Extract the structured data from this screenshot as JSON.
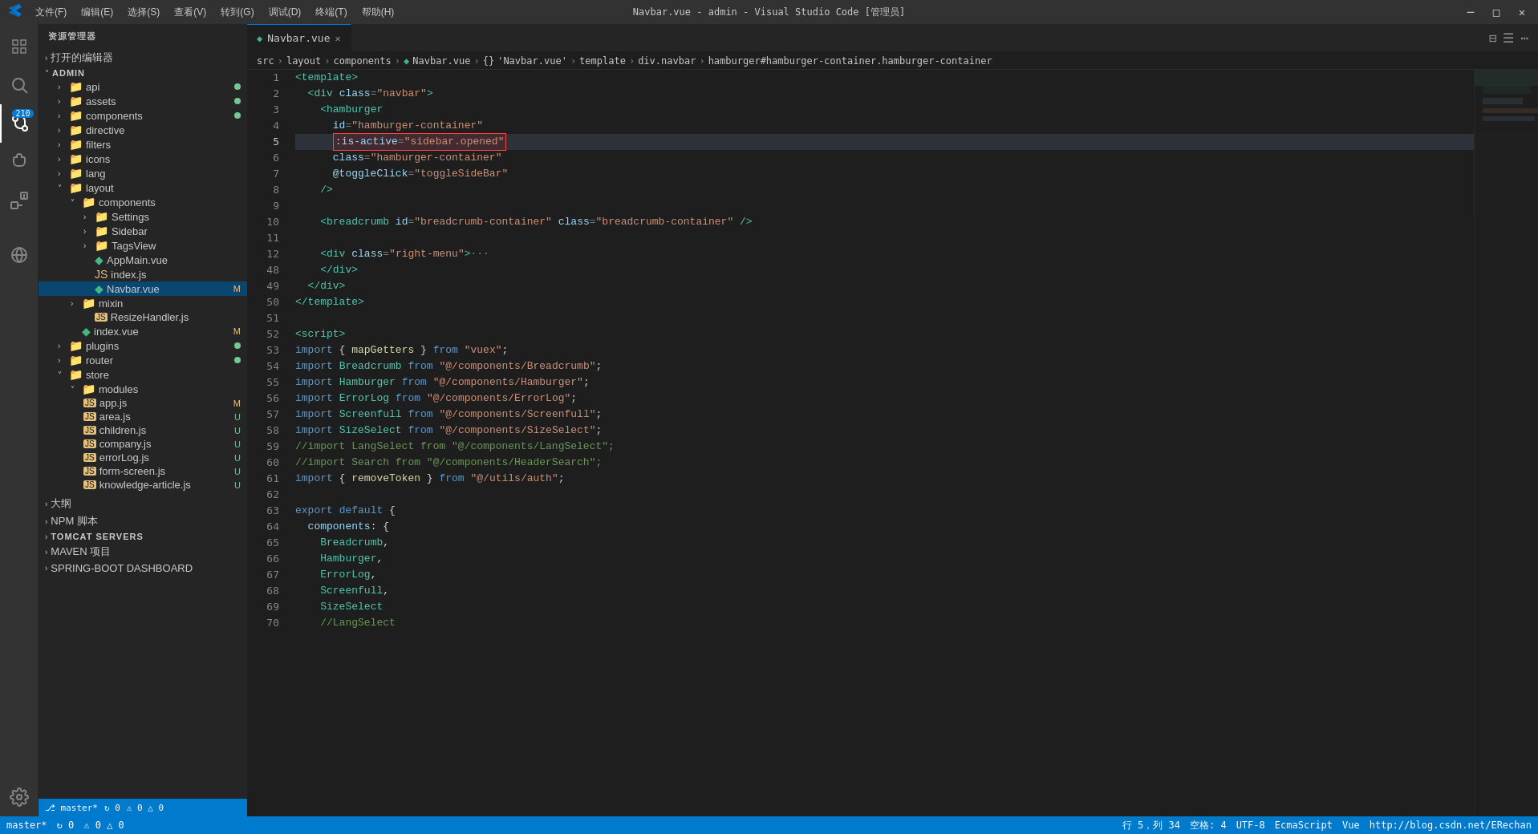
{
  "titleBar": {
    "title": "Navbar.vue - admin - Visual Studio Code [管理员]",
    "menus": [
      "文件(F)",
      "编辑(E)",
      "选择(S)",
      "查看(V)",
      "转到(G)",
      "调试(D)",
      "终端(T)",
      "帮助(H)"
    ]
  },
  "sidebar": {
    "title": "资源管理器",
    "openEditors": "打开的编辑器",
    "rootName": "ADMIN",
    "items": [
      {
        "label": "api",
        "type": "folder",
        "indent": 1,
        "dot": "green"
      },
      {
        "label": "assets",
        "type": "folder",
        "indent": 1,
        "dot": "green"
      },
      {
        "label": "components",
        "type": "folder",
        "indent": 1,
        "dot": "green",
        "expanded": true
      },
      {
        "label": "directive",
        "type": "folder",
        "indent": 1,
        "dot": ""
      },
      {
        "label": "filters",
        "type": "folder",
        "indent": 1,
        "dot": ""
      },
      {
        "label": "icons",
        "type": "folder",
        "indent": 1,
        "dot": ""
      },
      {
        "label": "lang",
        "type": "folder",
        "indent": 1,
        "dot": ""
      },
      {
        "label": "layout",
        "type": "folder",
        "indent": 1,
        "expanded": true
      },
      {
        "label": "components",
        "type": "folder",
        "indent": 2,
        "expanded": true
      },
      {
        "label": "Settings",
        "type": "folder",
        "indent": 3
      },
      {
        "label": "Sidebar",
        "type": "folder",
        "indent": 3
      },
      {
        "label": "TagsView",
        "type": "folder",
        "indent": 3
      },
      {
        "label": "AppMain.vue",
        "type": "vue",
        "indent": 3
      },
      {
        "label": "index.js",
        "type": "js",
        "indent": 3
      },
      {
        "label": "Navbar.vue",
        "type": "vue",
        "indent": 3,
        "badge": "M",
        "selected": true
      },
      {
        "label": "mixin",
        "type": "folder",
        "indent": 2
      },
      {
        "label": "ResizeHandler.js",
        "type": "js",
        "indent": 3
      },
      {
        "label": "index.vue",
        "type": "vue",
        "indent": 2,
        "badge": "M"
      },
      {
        "label": "plugins",
        "type": "folder",
        "indent": 1,
        "dot": "green"
      },
      {
        "label": "router",
        "type": "folder",
        "indent": 1,
        "dot": "green"
      },
      {
        "label": "store",
        "type": "folder",
        "indent": 1,
        "expanded": true
      },
      {
        "label": "modules",
        "type": "folder",
        "indent": 2,
        "expanded": true
      },
      {
        "label": "app.js",
        "type": "js",
        "indent": 3,
        "badge": "M"
      },
      {
        "label": "area.js",
        "type": "js",
        "indent": 3,
        "badge": "U"
      },
      {
        "label": "children.js",
        "type": "js",
        "indent": 3,
        "badge": "U"
      },
      {
        "label": "company.js",
        "type": "js",
        "indent": 3,
        "badge": "U"
      },
      {
        "label": "errorLog.js",
        "type": "js",
        "indent": 3,
        "badge": "U"
      },
      {
        "label": "form-screen.js",
        "type": "js",
        "indent": 3,
        "badge": "U"
      },
      {
        "label": "knowledge-article.js",
        "type": "js",
        "indent": 3,
        "badge": "U"
      },
      {
        "label": "大纲",
        "type": "section"
      },
      {
        "label": "NPM 脚本",
        "type": "section"
      },
      {
        "label": "TOMCAT SERVERS",
        "type": "section"
      },
      {
        "label": "MAVEN 项目",
        "type": "section"
      },
      {
        "label": "SPRING-BOOT DASHBOARD",
        "type": "section"
      }
    ]
  },
  "tabs": [
    {
      "label": "Navbar.vue",
      "active": true,
      "icon": "vue"
    }
  ],
  "breadcrumb": [
    "src",
    "layout",
    "components",
    "Navbar.vue",
    "{}",
    "Navbar.vue'",
    "template",
    "div.navbar",
    "hamburger#hamburger-container.hamburger-container"
  ],
  "editor": {
    "lines": [
      {
        "num": 1,
        "tokens": [
          {
            "t": "tag",
            "v": "<template>"
          }
        ]
      },
      {
        "num": 2,
        "tokens": [
          {
            "t": "plain",
            "v": "  "
          },
          {
            "t": "tag",
            "v": "<div"
          },
          {
            "t": "plain",
            "v": " "
          },
          {
            "t": "attr",
            "v": "class"
          },
          {
            "t": "punct",
            "v": "="
          },
          {
            "t": "str",
            "v": "\"navbar\""
          },
          {
            "t": "tag",
            "v": ">"
          }
        ]
      },
      {
        "num": 3,
        "tokens": [
          {
            "t": "plain",
            "v": "    "
          },
          {
            "t": "tag",
            "v": "<hamburger"
          }
        ]
      },
      {
        "num": 4,
        "tokens": [
          {
            "t": "plain",
            "v": "      "
          },
          {
            "t": "attr",
            "v": "id"
          },
          {
            "t": "punct",
            "v": "="
          },
          {
            "t": "str",
            "v": "\"hamburger-container\""
          }
        ]
      },
      {
        "num": 5,
        "tokens": [
          {
            "t": "red-border",
            "v": "      :is-active=\"sidebar.opened\""
          }
        ]
      },
      {
        "num": 6,
        "tokens": [
          {
            "t": "plain",
            "v": "      "
          },
          {
            "t": "attr",
            "v": "class"
          },
          {
            "t": "punct",
            "v": "="
          },
          {
            "t": "str",
            "v": "\"hamburger-container\""
          }
        ]
      },
      {
        "num": 7,
        "tokens": [
          {
            "t": "plain",
            "v": "      "
          },
          {
            "t": "attr",
            "v": "@toggleClick"
          },
          {
            "t": "punct",
            "v": "="
          },
          {
            "t": "str",
            "v": "\"toggleSideBar\""
          }
        ]
      },
      {
        "num": 8,
        "tokens": [
          {
            "t": "plain",
            "v": "    "
          },
          {
            "t": "tag",
            "v": "/>"
          }
        ]
      },
      {
        "num": 9,
        "tokens": []
      },
      {
        "num": 10,
        "tokens": [
          {
            "t": "plain",
            "v": "    "
          },
          {
            "t": "tag",
            "v": "<breadcrumb"
          },
          {
            "t": "plain",
            "v": " "
          },
          {
            "t": "attr",
            "v": "id"
          },
          {
            "t": "punct",
            "v": "="
          },
          {
            "t": "str",
            "v": "\"breadcrumb-container\""
          },
          {
            "t": "plain",
            "v": " "
          },
          {
            "t": "attr",
            "v": "class"
          },
          {
            "t": "punct",
            "v": "="
          },
          {
            "t": "str",
            "v": "\"breadcrumb-container\""
          },
          {
            "t": "plain",
            "v": " "
          },
          {
            "t": "tag",
            "v": "/>"
          }
        ]
      },
      {
        "num": 11,
        "tokens": []
      },
      {
        "num": 12,
        "tokens": [
          {
            "t": "plain",
            "v": "    "
          },
          {
            "t": "tag",
            "v": "<div"
          },
          {
            "t": "plain",
            "v": " "
          },
          {
            "t": "attr",
            "v": "class"
          },
          {
            "t": "punct",
            "v": "="
          },
          {
            "t": "str",
            "v": "\"right-menu\""
          },
          {
            "t": "tag",
            "v": ">"
          },
          {
            "t": "comment",
            "v": "···"
          }
        ]
      },
      {
        "num": 48,
        "tokens": [
          {
            "t": "plain",
            "v": "    "
          },
          {
            "t": "tag",
            "v": "</div>"
          }
        ]
      },
      {
        "num": 49,
        "tokens": [
          {
            "t": "plain",
            "v": "  "
          },
          {
            "t": "tag",
            "v": "</div>"
          }
        ]
      },
      {
        "num": 50,
        "tokens": [
          {
            "t": "tag",
            "v": "</template>"
          }
        ]
      },
      {
        "num": 51,
        "tokens": []
      },
      {
        "num": 52,
        "tokens": [
          {
            "t": "tag",
            "v": "<script>"
          }
        ]
      },
      {
        "num": 53,
        "tokens": [
          {
            "t": "kw",
            "v": "import"
          },
          {
            "t": "plain",
            "v": " { "
          },
          {
            "t": "func",
            "v": "mapGetters"
          },
          {
            "t": "plain",
            "v": " } "
          },
          {
            "t": "kw",
            "v": "from"
          },
          {
            "t": "plain",
            "v": " "
          },
          {
            "t": "str",
            "v": "\"vuex\""
          },
          {
            "t": "plain",
            "v": ";"
          }
        ]
      },
      {
        "num": 54,
        "tokens": [
          {
            "t": "kw",
            "v": "import"
          },
          {
            "t": "plain",
            "v": " "
          },
          {
            "t": "class",
            "v": "Breadcrumb"
          },
          {
            "t": "plain",
            "v": " "
          },
          {
            "t": "kw",
            "v": "from"
          },
          {
            "t": "plain",
            "v": " "
          },
          {
            "t": "str",
            "v": "\"@/components/Breadcrumb\""
          },
          {
            "t": "plain",
            "v": ";"
          }
        ]
      },
      {
        "num": 55,
        "tokens": [
          {
            "t": "kw",
            "v": "import"
          },
          {
            "t": "plain",
            "v": " "
          },
          {
            "t": "class",
            "v": "Hamburger"
          },
          {
            "t": "plain",
            "v": " "
          },
          {
            "t": "kw",
            "v": "from"
          },
          {
            "t": "plain",
            "v": " "
          },
          {
            "t": "str",
            "v": "\"@/components/Hamburger\""
          },
          {
            "t": "plain",
            "v": ";"
          }
        ]
      },
      {
        "num": 56,
        "tokens": [
          {
            "t": "kw",
            "v": "import"
          },
          {
            "t": "plain",
            "v": " "
          },
          {
            "t": "class",
            "v": "ErrorLog"
          },
          {
            "t": "plain",
            "v": " "
          },
          {
            "t": "kw",
            "v": "from"
          },
          {
            "t": "plain",
            "v": " "
          },
          {
            "t": "str",
            "v": "\"@/components/ErrorLog\""
          },
          {
            "t": "plain",
            "v": ";"
          }
        ]
      },
      {
        "num": 57,
        "tokens": [
          {
            "t": "kw",
            "v": "import"
          },
          {
            "t": "plain",
            "v": " "
          },
          {
            "t": "class",
            "v": "Screenfull"
          },
          {
            "t": "plain",
            "v": " "
          },
          {
            "t": "kw",
            "v": "from"
          },
          {
            "t": "plain",
            "v": " "
          },
          {
            "t": "str",
            "v": "\"@/components/Screenfull\""
          },
          {
            "t": "plain",
            "v": ";"
          }
        ]
      },
      {
        "num": 58,
        "tokens": [
          {
            "t": "kw",
            "v": "import"
          },
          {
            "t": "plain",
            "v": " "
          },
          {
            "t": "class",
            "v": "SizeSelect"
          },
          {
            "t": "plain",
            "v": " "
          },
          {
            "t": "kw",
            "v": "from"
          },
          {
            "t": "plain",
            "v": " "
          },
          {
            "t": "str",
            "v": "\"@/components/SizeSelect\""
          },
          {
            "t": "plain",
            "v": ";"
          }
        ]
      },
      {
        "num": 59,
        "tokens": [
          {
            "t": "comment",
            "v": "//import LangSelect from \"@/components/LangSelect\";"
          }
        ]
      },
      {
        "num": 60,
        "tokens": [
          {
            "t": "comment",
            "v": "//import Search from \"@/components/HeaderSearch\";"
          }
        ]
      },
      {
        "num": 61,
        "tokens": [
          {
            "t": "kw",
            "v": "import"
          },
          {
            "t": "plain",
            "v": " { "
          },
          {
            "t": "func",
            "v": "removeToken"
          },
          {
            "t": "plain",
            "v": " } "
          },
          {
            "t": "kw",
            "v": "from"
          },
          {
            "t": "plain",
            "v": " "
          },
          {
            "t": "str",
            "v": "\"@/utils/auth\""
          },
          {
            "t": "plain",
            "v": ";"
          }
        ]
      },
      {
        "num": 62,
        "tokens": []
      },
      {
        "num": 63,
        "tokens": [
          {
            "t": "kw",
            "v": "export"
          },
          {
            "t": "plain",
            "v": " "
          },
          {
            "t": "kw",
            "v": "default"
          },
          {
            "t": "plain",
            "v": " {"
          }
        ]
      },
      {
        "num": 64,
        "tokens": [
          {
            "t": "plain",
            "v": "  "
          },
          {
            "t": "prop",
            "v": "components"
          },
          {
            "t": "plain",
            "v": ": {"
          }
        ]
      },
      {
        "num": 65,
        "tokens": [
          {
            "t": "plain",
            "v": "    "
          },
          {
            "t": "class",
            "v": "Breadcrumb"
          },
          {
            "t": "plain",
            "v": ","
          }
        ]
      },
      {
        "num": 66,
        "tokens": [
          {
            "t": "plain",
            "v": "    "
          },
          {
            "t": "class",
            "v": "Hamburger"
          },
          {
            "t": "plain",
            "v": ","
          }
        ]
      },
      {
        "num": 67,
        "tokens": [
          {
            "t": "plain",
            "v": "    "
          },
          {
            "t": "class",
            "v": "ErrorLog"
          },
          {
            "t": "plain",
            "v": ","
          }
        ]
      },
      {
        "num": 68,
        "tokens": [
          {
            "t": "plain",
            "v": "    "
          },
          {
            "t": "class",
            "v": "Screenfull"
          },
          {
            "t": "plain",
            "v": ","
          }
        ]
      },
      {
        "num": 69,
        "tokens": [
          {
            "t": "plain",
            "v": "    "
          },
          {
            "t": "class",
            "v": "SizeSelect"
          }
        ]
      },
      {
        "num": 70,
        "tokens": [
          {
            "t": "comment",
            "v": "    //LangSelect"
          }
        ]
      }
    ]
  },
  "statusBar": {
    "branch": "master*",
    "sync": "↻ 0",
    "errors": "⚠ 0 △ 0",
    "position": "行 5，列 34",
    "encoding": "空格: 4",
    "lineEnding": "UTF-8",
    "language": "EcmaScript",
    "format": "Vue",
    "bottom": "http://blog.csdn.net/ERechan"
  }
}
